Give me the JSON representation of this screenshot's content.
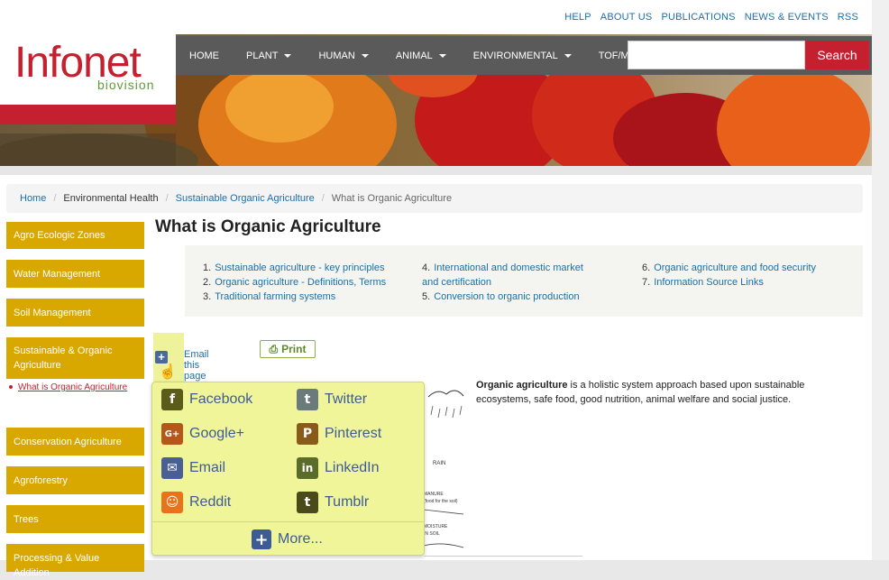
{
  "toplinks": [
    "HELP",
    "ABOUT US",
    "PUBLICATIONS",
    "NEWS & EVENTS",
    "RSS"
  ],
  "logo": {
    "word": "Infonet",
    "sub": "biovision"
  },
  "nav": [
    {
      "label": "HOME",
      "dropdown": false
    },
    {
      "label": "PLANT",
      "dropdown": true
    },
    {
      "label": "HUMAN",
      "dropdown": true
    },
    {
      "label": "ANIMAL",
      "dropdown": true
    },
    {
      "label": "ENVIRONMENTAL",
      "dropdown": true
    },
    {
      "label": "TOF/MKM",
      "dropdown": false
    }
  ],
  "search": {
    "value": "",
    "button": "Search"
  },
  "breadcrumb": [
    {
      "label": "Home",
      "style": "link"
    },
    {
      "label": "Environmental Health",
      "style": "plain"
    },
    {
      "label": "Sustainable Organic Agriculture",
      "style": "link"
    },
    {
      "label": "What is Organic Agriculture",
      "style": "current"
    }
  ],
  "sidebar": {
    "items": [
      "Agro Ecologic Zones",
      "Water Management",
      "Soil Management",
      "Sustainable & Organic Agriculture",
      "Conservation Agriculture",
      "Agroforestry",
      "Trees",
      "Processing & Value Addition"
    ],
    "subitem": "What is Organic Agriculture"
  },
  "title": "What is Organic Agriculture",
  "toc": [
    [
      "1.",
      "Sustainable agriculture - key principles"
    ],
    [
      "2.",
      "Organic agriculture - Definitions, Terms"
    ],
    [
      "3.",
      "Traditional farming systems"
    ],
    [
      "4.",
      "International and domestic market and certification"
    ],
    [
      "5.",
      "Conversion to organic production"
    ],
    [
      "6.",
      "Organic agriculture and food security"
    ],
    [
      "7.",
      "Information Source Links"
    ]
  ],
  "share": {
    "email_link": "Email this page",
    "print": "Print",
    "items": [
      {
        "label": "Facebook",
        "icon": "facebook-icon",
        "color": "#5b5b1a",
        "glyph": "f"
      },
      {
        "label": "Twitter",
        "icon": "twitter-icon",
        "color": "#6b7a7a",
        "glyph": "t"
      },
      {
        "label": "Google+",
        "icon": "google-plus-icon",
        "color": "#b5561a",
        "glyph": "G+"
      },
      {
        "label": "Pinterest",
        "icon": "pinterest-icon",
        "color": "#8a5a1a",
        "glyph": "P"
      },
      {
        "label": "Email",
        "icon": "email-icon",
        "color": "#4a5f96",
        "glyph": "✉"
      },
      {
        "label": "LinkedIn",
        "icon": "linkedin-icon",
        "color": "#5b6b2a",
        "glyph": "in"
      },
      {
        "label": "Reddit",
        "icon": "reddit-icon",
        "color": "#e8731a",
        "glyph": "☺"
      },
      {
        "label": "Tumblr",
        "icon": "tumblr-icon",
        "color": "#4a4a1a",
        "glyph": "t"
      }
    ],
    "more": "More..."
  },
  "body": {
    "bold": "Organic agriculture",
    "text": " is a holistic system approach based upon sustainable ecosystems, safe food, good nutrition, animal welfare and social justice."
  },
  "sketch_labels": [
    "RAIN",
    "MANURE",
    "(food for the soil)",
    "MOISTURE",
    "IN SOIL"
  ],
  "colors": {
    "brand_red": "#c5202f",
    "sidebar_gold": "#d9a800",
    "link_blue": "#1a6fa8",
    "popup_yellow": "#f1f59a"
  }
}
